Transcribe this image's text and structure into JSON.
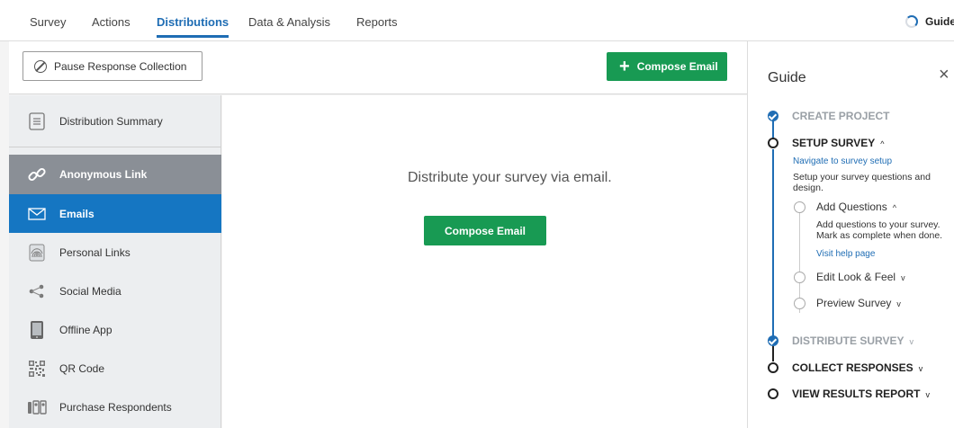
{
  "nav": {
    "tabs": [
      "Survey",
      "Actions",
      "Distributions",
      "Data & Analysis",
      "Reports"
    ],
    "active_tab": "Distributions",
    "guide_label": "Guide"
  },
  "toolbar": {
    "pause_label": "Pause Response Collection",
    "compose_label": "Compose Email"
  },
  "sidebar": {
    "items": [
      {
        "label": "Distribution Summary",
        "icon": "document-lines-icon"
      },
      {
        "label": "Anonymous Link",
        "icon": "link-icon"
      },
      {
        "label": "Emails",
        "icon": "envelope-icon"
      },
      {
        "label": "Personal Links",
        "icon": "fingerprint-icon"
      },
      {
        "label": "Social Media",
        "icon": "share-icon"
      },
      {
        "label": "Offline App",
        "icon": "tablet-icon"
      },
      {
        "label": "QR Code",
        "icon": "qr-code-icon"
      },
      {
        "label": "Purchase Respondents",
        "icon": "people-icon"
      }
    ],
    "selected": "Emails"
  },
  "main": {
    "message": "Distribute your survey via email.",
    "compose_label": "Compose Email"
  },
  "guide": {
    "title": "Guide",
    "close": "×",
    "steps": [
      {
        "label": "CREATE PROJECT",
        "status": "done"
      },
      {
        "label": "SETUP SURVEY",
        "status": "current"
      },
      {
        "label": "DISTRIBUTE SURVEY",
        "status": "done"
      },
      {
        "label": "COLLECT RESPONSES",
        "status": "todo"
      },
      {
        "label": "VIEW RESULTS REPORT",
        "status": "todo"
      }
    ],
    "setup": {
      "link": "Navigate to survey setup",
      "description": "Setup your survey questions and design.",
      "substeps": [
        {
          "label": "Add Questions",
          "expanded": true
        },
        {
          "label": "Edit Look & Feel",
          "expanded": false
        },
        {
          "label": "Preview Survey",
          "expanded": false
        }
      ],
      "add_questions_text": "Add questions to your survey. Mark as complete when done.",
      "help_link": "Visit help page"
    }
  },
  "colors": {
    "accent": "#1f6db4",
    "green": "#189a53",
    "selected_item": "#1576c2",
    "anon_item": "#8a8f96"
  }
}
